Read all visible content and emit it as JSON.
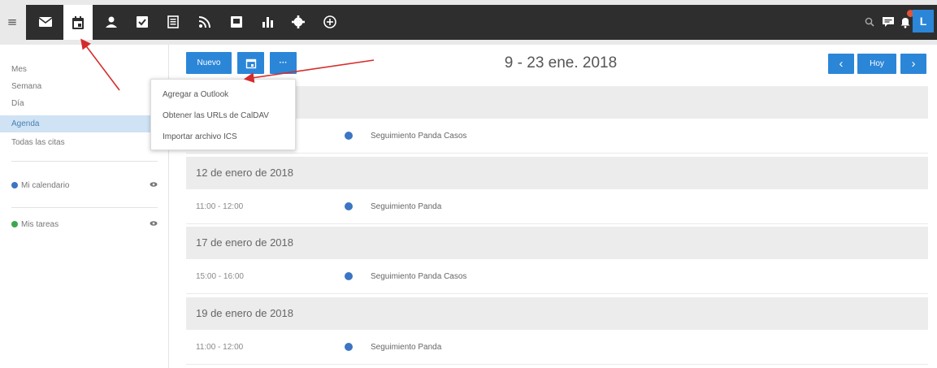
{
  "topbar": {
    "menu_glyph": "≡",
    "apps": [
      {
        "icon": "mail-icon",
        "label": "Correo"
      },
      {
        "icon": "calendar-icon",
        "label": "Calendario"
      },
      {
        "icon": "contacts-icon",
        "label": "Contactos"
      },
      {
        "icon": "tasks-icon",
        "label": "Tareas"
      },
      {
        "icon": "notes-icon",
        "label": "Notas"
      },
      {
        "icon": "rss-icon",
        "label": "RSS"
      },
      {
        "icon": "inbox-icon",
        "label": "Archivo"
      },
      {
        "icon": "stats-icon",
        "label": "Estadísticas"
      },
      {
        "icon": "settings-icon",
        "label": "Ajustes"
      },
      {
        "icon": "add-circle-icon",
        "label": "Más"
      }
    ],
    "active_app": "calendar-icon",
    "user_initial": "L",
    "colors": {
      "bar": "#2e2e2e",
      "accent": "#2b86d8",
      "badge": "#e0543a"
    }
  },
  "sidebar": {
    "views": [
      {
        "label": "Mes",
        "active": false
      },
      {
        "label": "Semana",
        "active": false
      },
      {
        "label": "Día",
        "active": false
      },
      {
        "label": "Agenda",
        "active": true
      },
      {
        "label": "Todas las citas",
        "active": false
      }
    ],
    "calendars": [
      {
        "label": "Mi calendario",
        "color": "#3c75c2"
      },
      {
        "label": "Mis tareas",
        "color": "#3aa84a"
      }
    ]
  },
  "toolbar": {
    "new_label": "Nuevo",
    "more_label": "···",
    "date_range": "9 - 23 ene. 2018",
    "today_label": "Hoy",
    "prev_glyph": "‹",
    "next_glyph": "›"
  },
  "dropdown": {
    "items": [
      "Agregar a Outlook",
      "Obtener las URLs de CalDAV",
      "Importar archivo ICS"
    ]
  },
  "agenda": {
    "days": [
      {
        "date": "",
        "events": [
          {
            "time": "",
            "title": "Seguimiento Panda Casos"
          }
        ]
      },
      {
        "date": "12 de enero de 2018",
        "events": [
          {
            "time": "11:00 - 12:00",
            "title": "Seguimiento Panda"
          }
        ]
      },
      {
        "date": "17 de enero de 2018",
        "events": [
          {
            "time": "15:00 - 16:00",
            "title": "Seguimiento Panda Casos"
          }
        ]
      },
      {
        "date": "19 de enero de 2018",
        "events": [
          {
            "time": "11:00 - 12:00",
            "title": "Seguimiento Panda"
          }
        ]
      }
    ]
  }
}
